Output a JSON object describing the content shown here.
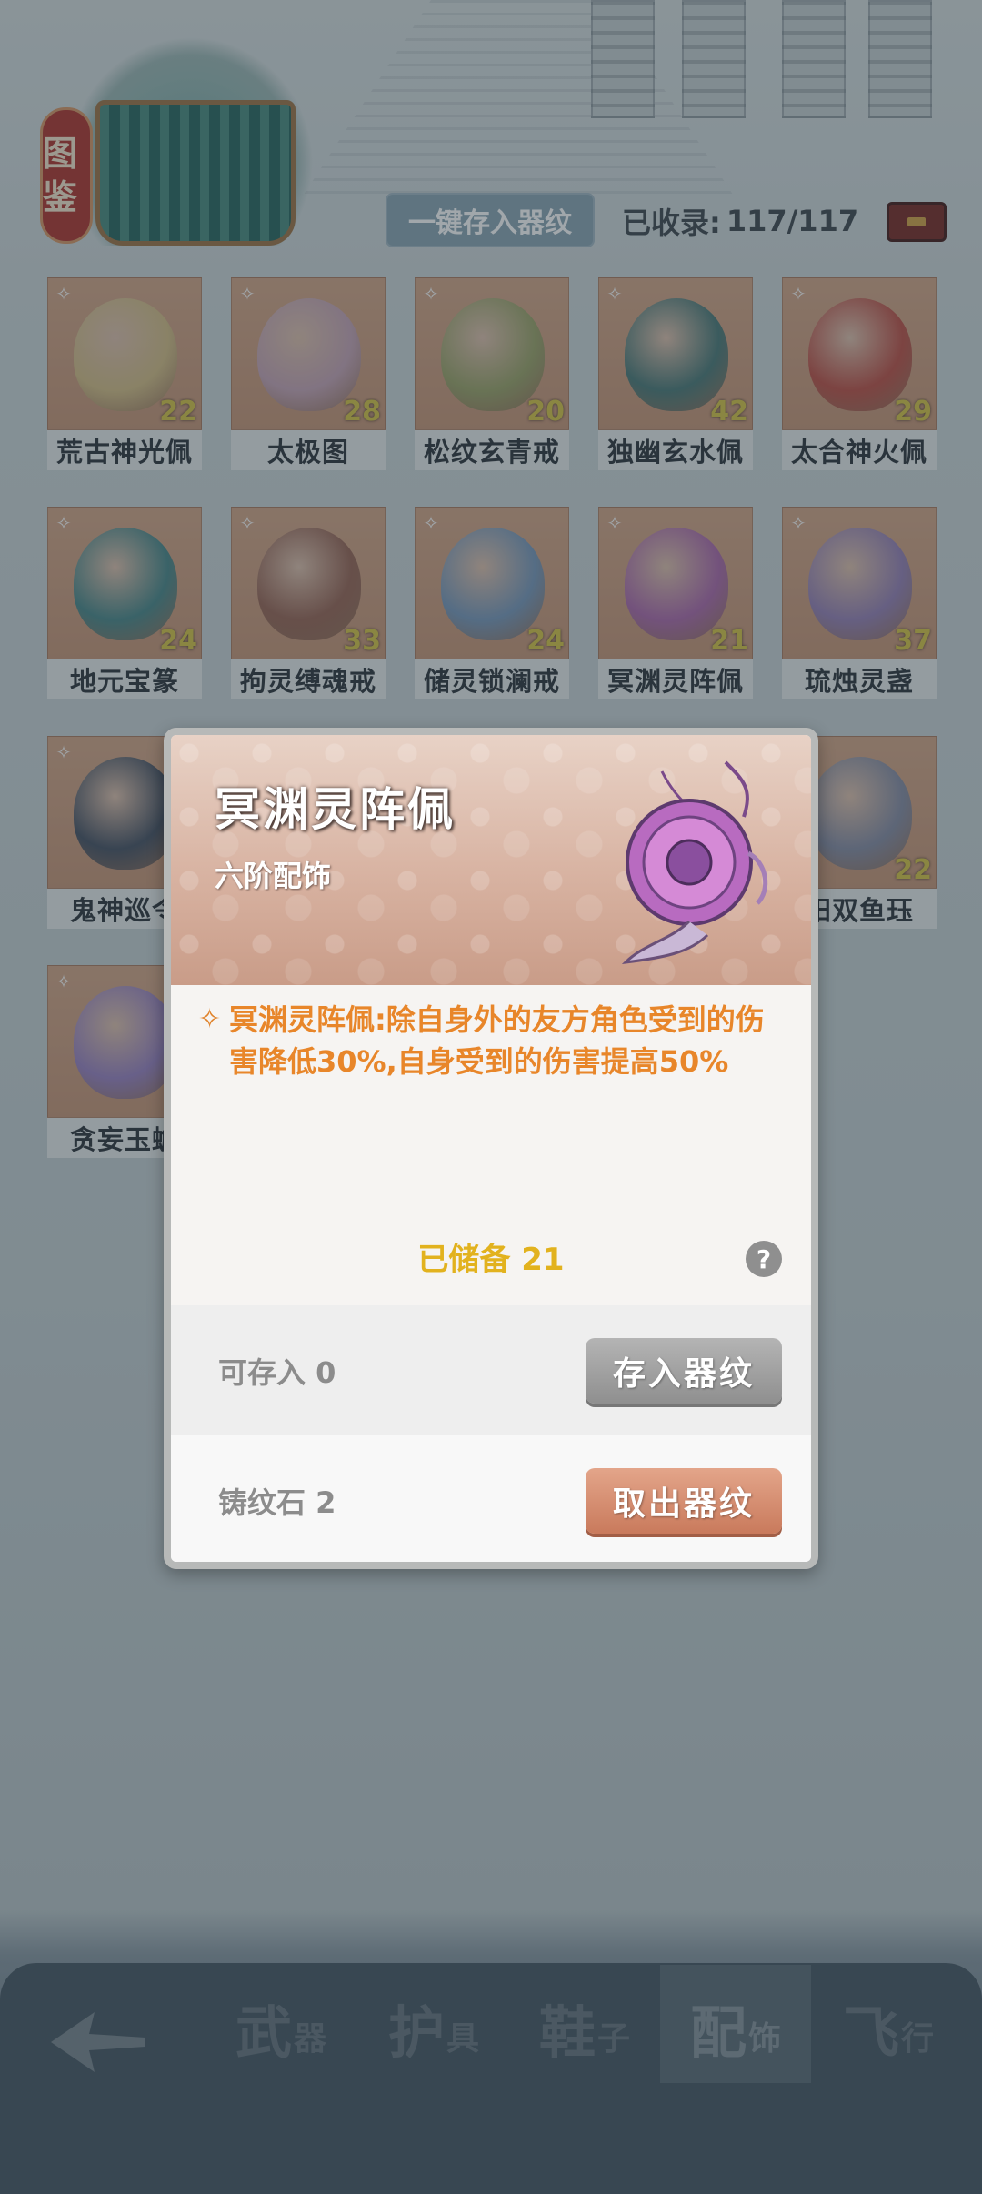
{
  "header": {
    "tujian_label": "图鉴",
    "store_all_label": "一键存入器纹",
    "collected_label": "已收录:",
    "collected_value": "117/117"
  },
  "items": [
    {
      "name": "荒古神光佩",
      "count": "22",
      "color": "#d7c089"
    },
    {
      "name": "太极图",
      "count": "28",
      "color": "#c9a7b8"
    },
    {
      "name": "松纹玄青戒",
      "count": "20",
      "color": "#9fa66c"
    },
    {
      "name": "独幽玄水佩",
      "count": "42",
      "color": "#4f7c7a"
    },
    {
      "name": "太合神火佩",
      "count": "29",
      "color": "#c0544a"
    },
    {
      "name": "地元宝篆",
      "count": "24",
      "color": "#4e8a8c"
    },
    {
      "name": "拘灵缚魂戒",
      "count": "33",
      "color": "#9b6858"
    },
    {
      "name": "储灵锁澜戒",
      "count": "24",
      "color": "#7c9bbd"
    },
    {
      "name": "冥渊灵阵佩",
      "count": "21",
      "color": "#b06dae"
    },
    {
      "name": "琉烛灵盏",
      "count": "37",
      "color": "#9a84b8"
    },
    {
      "name": "鬼神巡令",
      "count": "",
      "color": "#4b5566"
    },
    {
      "name": "",
      "count": "",
      "color": "#c9987a"
    },
    {
      "name": "",
      "count": "",
      "color": "#c9987a"
    },
    {
      "name": "",
      "count": "",
      "color": "#c9987a"
    },
    {
      "name": "阳双鱼珏",
      "count": "22",
      "color": "#8a8fa6"
    },
    {
      "name": "贪妄玉蟾",
      "count": "",
      "color": "#9d85c4"
    }
  ],
  "modal": {
    "title": "冥渊灵阵佩",
    "subtitle": "六阶配饰",
    "description": "冥渊灵阵佩:除自身外的友方角色受到的伤害降低30%,自身受到的伤害提高50%",
    "stored_text": "已储备 21",
    "help_symbol": "?",
    "row1_label": "可存入 0",
    "row1_button": "存入器纹",
    "row2_label": "铸纹石 2",
    "row2_button": "取出器纹"
  },
  "tabs": [
    {
      "big": "武",
      "small": "器"
    },
    {
      "big": "护",
      "small": "具"
    },
    {
      "big": "鞋",
      "small": "子"
    },
    {
      "big": "配",
      "small": "饰"
    },
    {
      "big": "飞",
      "small": "行"
    }
  ],
  "colors": {
    "accent_orange": "#e8862a",
    "stored_gold": "#e2b21e",
    "count_yellow": "#d8c64a"
  }
}
